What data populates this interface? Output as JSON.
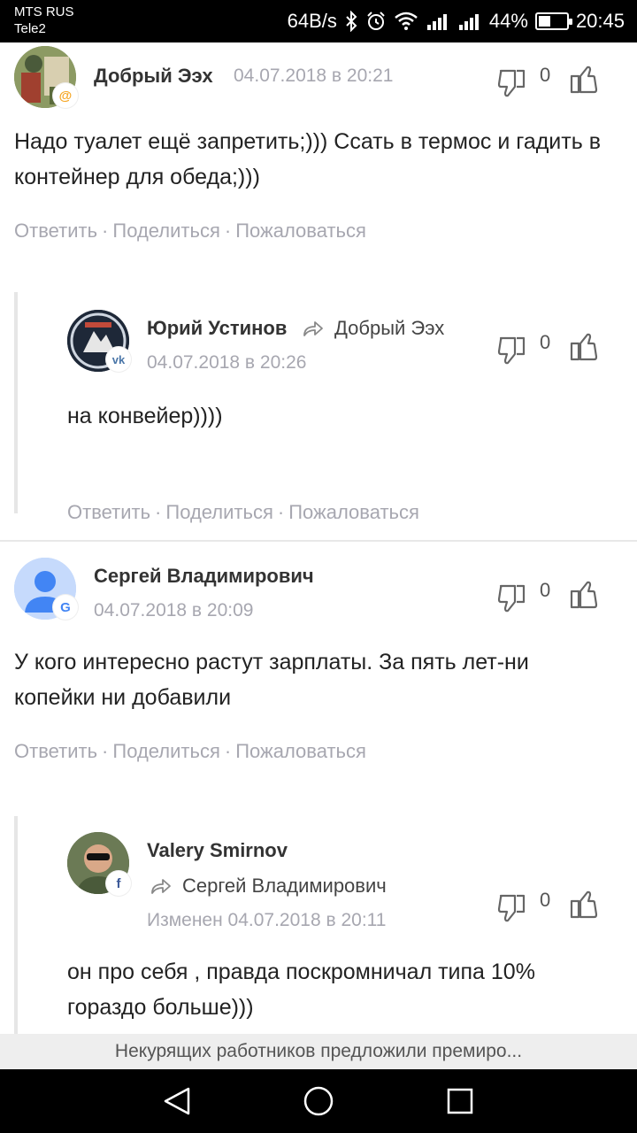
{
  "status_bar": {
    "carrier_1": "MTS RUS",
    "carrier_2": "Tele2",
    "net_speed": "64B/s",
    "battery_percent": "44%",
    "battery_level": 0.44,
    "time": "20:45"
  },
  "comments": [
    {
      "author": "Добрый Ээх",
      "date": "04.07.2018 в 20:21",
      "badge": "@",
      "text": "Надо туалет ещё запретить;))) Ссать в термос и гадить в контейнер для обеда;)))",
      "votes": "0",
      "actions": {
        "reply": "Ответить",
        "share": "Поделиться",
        "report": "Пожаловаться",
        "sep": "·"
      }
    },
    {
      "author": "Юрий Устинов",
      "reply_to": "Добрый Ээх",
      "date": "04.07.2018 в 20:26",
      "badge": "vk",
      "text": "на конвейер))))",
      "votes": "0",
      "actions": {
        "reply": "Ответить",
        "share": "Поделиться",
        "report": "Пожаловаться",
        "sep": "·"
      }
    },
    {
      "author": "Сергей Владимирович",
      "date": "04.07.2018 в 20:09",
      "badge": "G",
      "text": "У кого интересно растут зарплаты. За пять лет-ни копейки ни добавили",
      "votes": "0",
      "actions": {
        "reply": "Ответить",
        "share": "Поделиться",
        "report": "Пожаловаться",
        "sep": "·"
      }
    },
    {
      "author": "Valery Smirnov",
      "reply_to": "Сергей Владимирович",
      "date": "Изменен 04.07.2018 в 20:11",
      "badge": "f",
      "text": "он про себя , правда поскромничал типа 10% гораздо больше)))",
      "votes": "0"
    }
  ],
  "bottom_banner": "Некурящих работников предложили премиро...",
  "colors": {
    "meta_gray": "#a7a7b0",
    "vk_blue": "#4a76a8",
    "fb_blue": "#3b5998",
    "mail_orange": "#f5a623"
  },
  "icons": [
    "dislike-icon",
    "like-icon",
    "reply-arrow-icon",
    "back-icon",
    "home-icon",
    "recents-icon"
  ]
}
